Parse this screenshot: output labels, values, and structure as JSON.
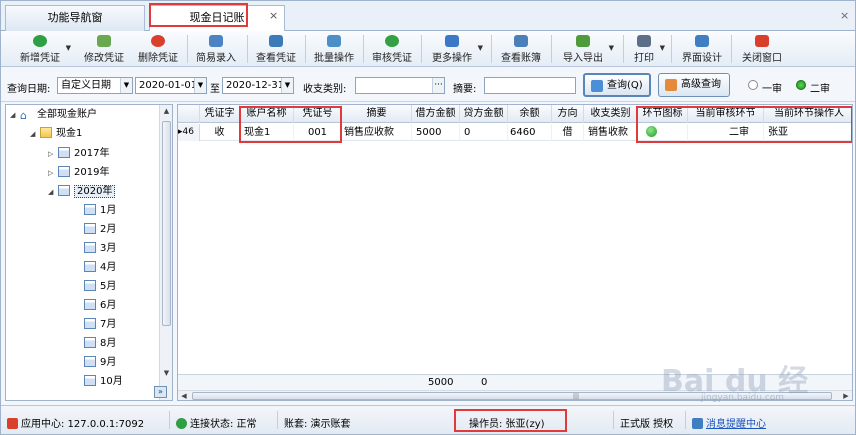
{
  "tabs": [
    {
      "label": "功能导航窗"
    },
    {
      "label": "现金日记账"
    }
  ],
  "toolbar": {
    "items": [
      {
        "label": "新增凭证",
        "icon": "add-icon",
        "color": "#2ea043"
      },
      {
        "label": "修改凭证",
        "icon": "edit-icon",
        "color": "#4a8a3a"
      },
      {
        "label": "删除凭证",
        "icon": "delete-icon",
        "color": "#d8402b"
      },
      {
        "label": "简易录入",
        "icon": "quick-entry-icon",
        "color": "#4b83c4"
      },
      {
        "label": "查看凭证",
        "icon": "view-voucher-icon",
        "color": "#3d7ab8"
      },
      {
        "label": "批量操作",
        "icon": "batch-icon",
        "color": "#4c8fc8"
      },
      {
        "label": "审核凭证",
        "icon": "approve-icon",
        "color": "#34a043"
      },
      {
        "label": "更多操作",
        "icon": "more-ops-icon",
        "color": "#3c78c8"
      },
      {
        "label": "查看账簿",
        "icon": "ledger-icon",
        "color": "#4a7fba"
      },
      {
        "label": "导入导出",
        "icon": "import-export-icon",
        "color": "#4f9b3c"
      },
      {
        "label": "打印",
        "icon": "print-icon",
        "color": "#5c6f86"
      },
      {
        "label": "界面设计",
        "icon": "design-icon",
        "color": "#3f7ec0"
      },
      {
        "label": "关闭窗口",
        "icon": "close-window-icon",
        "color": "#d8402b"
      }
    ]
  },
  "query": {
    "date_label": "查询日期:",
    "date_mode": "自定义日期",
    "date_from": "2020-01-01",
    "to_label": "至",
    "date_to": "2020-12-31",
    "category_label": "收支类别:",
    "category_value": "",
    "summary_label": "摘要:",
    "summary_value": "",
    "query_button": "查询(Q)",
    "advanced_button": "高级查询",
    "radio_first": "一审",
    "radio_second": "二审"
  },
  "tree": {
    "root": "全部现金账户",
    "account": "现金1",
    "years": [
      "2017年",
      "2019年",
      "2020年"
    ],
    "months": [
      "1月",
      "2月",
      "3月",
      "4月",
      "5月",
      "6月",
      "7月",
      "8月",
      "9月",
      "10月"
    ]
  },
  "grid": {
    "columns": [
      "凭证字",
      "账户名称",
      "凭证号",
      "摘要",
      "借方金额",
      "贷方金额",
      "余额",
      "方向",
      "收支类别",
      "环节图标",
      "当前审核环节",
      "当前环节操作人"
    ],
    "row": {
      "index": "46",
      "voucher_type": "收",
      "account": "现金1",
      "voucher_no": "001",
      "summary": "销售应收款",
      "debit": "5000",
      "credit": "0",
      "balance": "6460",
      "direction": "借",
      "category": "销售收款",
      "stage": "二审",
      "operator": "张亚"
    },
    "totals": {
      "debit": "5000",
      "credit": "0"
    }
  },
  "status": {
    "app_center": "应用中心: 127.0.0.1:7092",
    "connection": "连接状态: 正常",
    "account_set": "账套: 演示账套",
    "operator": "操作员: 张亚(zy)",
    "edition": "正式版 授权",
    "message": "消息提醒中心"
  },
  "watermark": {
    "text": "Bai du 经验",
    "sub": "jingyan.baidu.com"
  }
}
